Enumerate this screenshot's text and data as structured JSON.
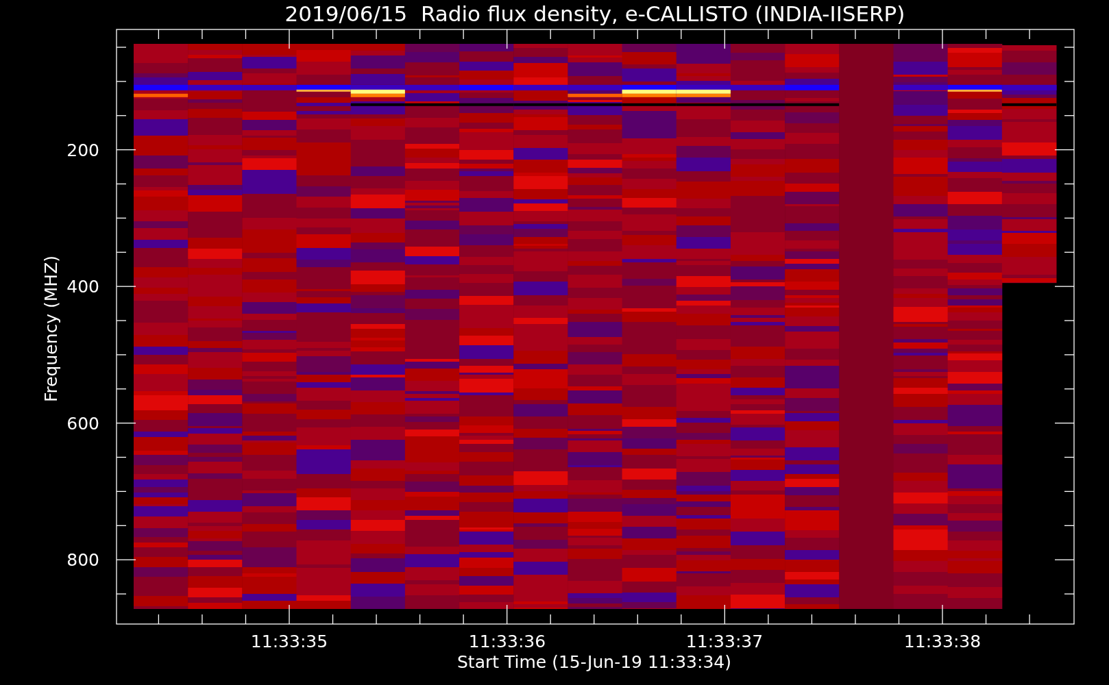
{
  "chart": {
    "title": "2019/06/15  Radio flux density, e-CALLISTO (INDIA-IISERP)",
    "y_axis": {
      "label": "Frequency (MHZ)",
      "ticks": [
        "200",
        "400",
        "600",
        "800"
      ]
    },
    "x_axis": {
      "label": "Start Time (15-Jun-19 11:33:34)",
      "ticks": [
        "11:33:35",
        "11:33:36",
        "11:33:37",
        "11:33:38"
      ]
    }
  }
}
